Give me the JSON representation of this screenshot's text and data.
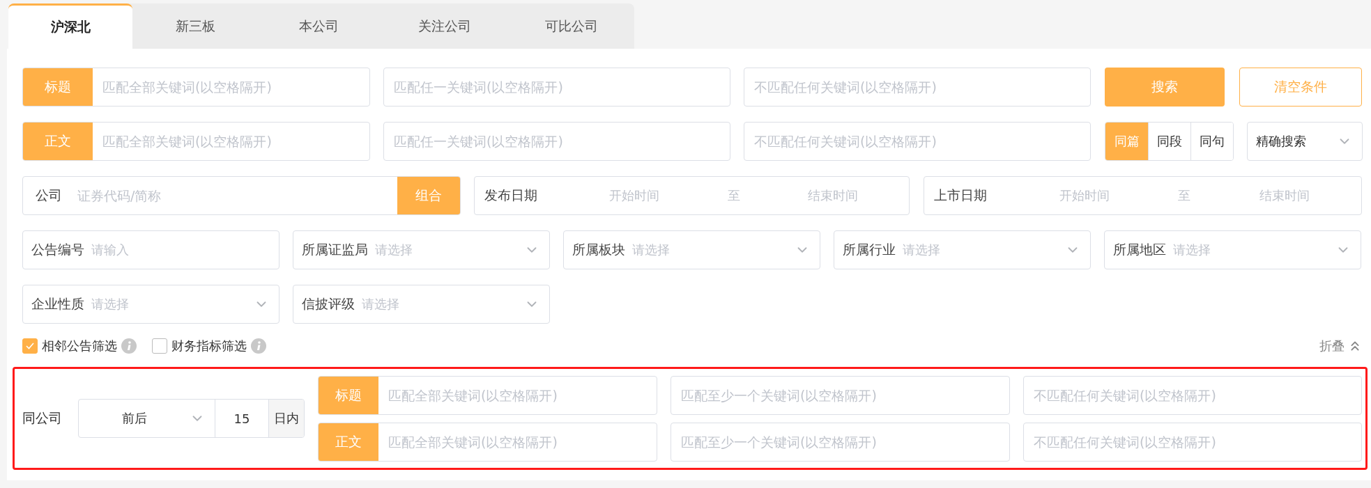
{
  "tabs": [
    {
      "label": "沪深北",
      "selected": true
    },
    {
      "label": "新三板",
      "selected": false
    },
    {
      "label": "本公司",
      "selected": false
    },
    {
      "label": "关注公司",
      "selected": false
    },
    {
      "label": "可比公司",
      "selected": false
    }
  ],
  "keyword_rows": [
    {
      "label": "标题",
      "fields": [
        {
          "placeholder": "匹配全部关键词(以空格隔开)"
        },
        {
          "placeholder": "匹配任一关键词(以空格隔开)"
        },
        {
          "placeholder": "不匹配任何关键词(以空格隔开)"
        }
      ]
    },
    {
      "label": "正文",
      "fields": [
        {
          "placeholder": "匹配全部关键词(以空格隔开)"
        },
        {
          "placeholder": "匹配任一关键词(以空格隔开)"
        },
        {
          "placeholder": "不匹配任何关键词(以空格隔开)"
        }
      ]
    }
  ],
  "search_button": "搜索",
  "clear_button": "清空条件",
  "scope_segments": [
    {
      "label": "同篇",
      "selected": true
    },
    {
      "label": "同段",
      "selected": false
    },
    {
      "label": "同句",
      "selected": false
    }
  ],
  "match_mode": {
    "value": "精确搜索"
  },
  "company": {
    "label": "公司",
    "placeholder": "证券代码/简称",
    "button": "组合"
  },
  "date_ranges": [
    {
      "label": "发布日期",
      "start_placeholder": "开始时间",
      "separator": "至",
      "end_placeholder": "结束时间"
    },
    {
      "label": "上市日期",
      "start_placeholder": "开始时间",
      "separator": "至",
      "end_placeholder": "结束时间"
    }
  ],
  "filters": [
    {
      "kind": "input",
      "label": "公告编号",
      "placeholder": "请输入"
    },
    {
      "kind": "select",
      "label": "所属证监局",
      "placeholder": "请选择"
    },
    {
      "kind": "select",
      "label": "所属板块",
      "placeholder": "请选择"
    },
    {
      "kind": "select",
      "label": "所属行业",
      "placeholder": "请选择"
    },
    {
      "kind": "select",
      "label": "所属地区",
      "placeholder": "请选择"
    },
    {
      "kind": "select",
      "label": "企业性质",
      "placeholder": "请选择"
    },
    {
      "kind": "select",
      "label": "信披评级",
      "placeholder": "请选择"
    }
  ],
  "options": [
    {
      "label": "相邻公告筛选",
      "checked": true
    },
    {
      "label": "财务指标筛选",
      "checked": false
    }
  ],
  "collapse_link": "折叠",
  "same_company": {
    "label": "同公司",
    "direction": "前后",
    "days": "15",
    "days_unit": "日内",
    "keyword_rows": [
      {
        "label": "标题",
        "fields": [
          {
            "placeholder": "匹配全部关键词(以空格隔开)"
          },
          {
            "placeholder": "匹配至少一个关键词(以空格隔开)"
          },
          {
            "placeholder": "不匹配任何关键词(以空格隔开)"
          }
        ]
      },
      {
        "label": "正文",
        "fields": [
          {
            "placeholder": "匹配全部关键词(以空格隔开)"
          },
          {
            "placeholder": "匹配至少一个关键词(以空格隔开)"
          },
          {
            "placeholder": "不匹配任何关键词(以空格隔开)"
          }
        ]
      }
    ]
  }
}
